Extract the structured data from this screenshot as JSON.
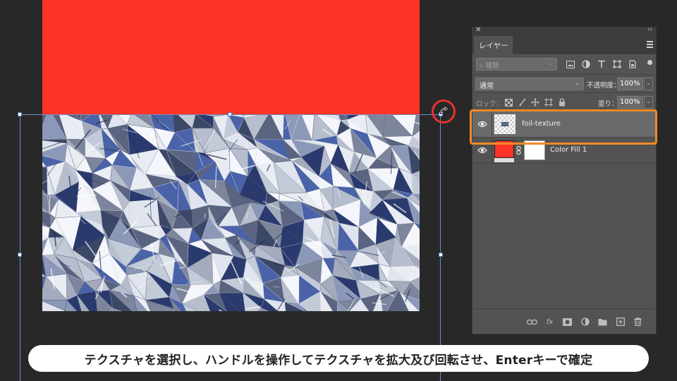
{
  "canvas": {
    "fill_color": "#ff3426",
    "layer_object": "foil-texture"
  },
  "layers_panel": {
    "tab_label": "レイヤー",
    "filter": {
      "placeholder": "種類",
      "icons": [
        "image-filter-icon",
        "adjustment-filter-icon",
        "type-filter-icon",
        "shape-filter-icon",
        "smartobject-filter-icon"
      ]
    },
    "blend_mode": "通常",
    "opacity_label": "不透明度：",
    "opacity_value": "100%",
    "lock_label": "ロック：",
    "lock_icons": [
      "lock-transparent-icon",
      "lock-image-icon",
      "lock-position-icon",
      "lock-artboard-icon",
      "lock-all-icon"
    ],
    "fill_label": "塗り：",
    "fill_value": "100%",
    "layers": [
      {
        "name": "foil-texture",
        "visible": true,
        "selected": true,
        "kind": "smart-object"
      },
      {
        "name": "Color Fill 1",
        "visible": true,
        "selected": false,
        "kind": "fill",
        "color": "#ff3426"
      }
    ],
    "footer_icons": [
      "link-layers-icon",
      "fx-icon",
      "add-mask-icon",
      "adjustment-layer-icon",
      "new-group-icon",
      "new-layer-icon",
      "delete-icon"
    ],
    "fx_label": "fx"
  },
  "caption": "テクスチャを選択し、ハンドルを操作してテクスチャを拡大及び回転させ、Enterキーで確定",
  "colors": {
    "highlight_ring": "#e8322e",
    "selection_outline": "#f08a26",
    "workspace_bg": "#282828",
    "panel_bg": "#535353"
  }
}
